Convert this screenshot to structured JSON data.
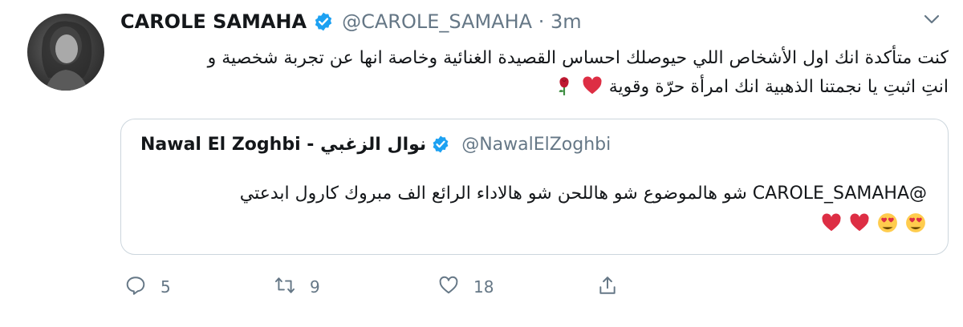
{
  "tweet": {
    "author_name": "CAROLE SAMAHA",
    "handle": "@CAROLE_SAMAHA",
    "separator": " · ",
    "time": "3m",
    "text_line1": "كنت متأكدة انك اول الأشخاص اللي حيوصلك احساس القصيدة الغنائية وخاصة انها عن تجربة شخصية و",
    "text_line2": "انتِ اثبتِ يا نجمتنا الذهبية انك امرأة حرّة وقوية",
    "emojis_line2": [
      "red-heart",
      "rose"
    ]
  },
  "quote": {
    "name": "Nawal El Zoghbi - نوال الزغبي",
    "handle": "@NawalElZoghbi",
    "mention": "@CAROLE_SAMAHA",
    "text": "شو هالموضوع شو هاللحن شو هالاداء الرائع الف مبروك كارول ابدعتي",
    "emojis": [
      "heart-eyes",
      "heart-eyes",
      "red-heart",
      "red-heart"
    ]
  },
  "actions": {
    "reply_count": "5",
    "retweet_count": "9",
    "like_count": "18"
  },
  "colors": {
    "verified_blue": "#1da1f2",
    "secondary_text": "#657786",
    "border": "#ccd6dd",
    "heart_red": "#dd2e44",
    "emoji_yellow": "#ffcc4d"
  },
  "icons": [
    "chevron-down-icon",
    "verified-badge-icon",
    "reply-icon",
    "retweet-icon",
    "like-icon",
    "share-icon"
  ]
}
